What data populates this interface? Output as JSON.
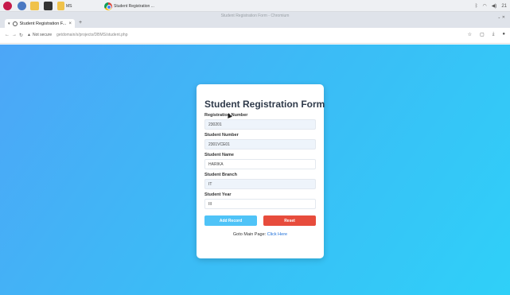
{
  "taskbar": {
    "item_label": "MS",
    "window_button": "Student Registration ...",
    "clock": "21"
  },
  "window": {
    "title": "Student Registration Form - Chromium"
  },
  "browser": {
    "tab_label": "Student Registration F...",
    "new_tab": "+",
    "security": "Not secure",
    "url": "getdomain/s/projects/DBMS/student.php"
  },
  "form": {
    "title": "Student Registration Form",
    "fields": [
      {
        "label": "Registration Number",
        "value": "230201"
      },
      {
        "label": "Student Number",
        "value": "2301VCE01"
      },
      {
        "label": "Student Name",
        "value": "HARIKA"
      },
      {
        "label": "Student Branch",
        "value": "IT"
      },
      {
        "label": "Student Year",
        "value": "III"
      }
    ],
    "submit_label": "Add Record",
    "reset_label": "Reset",
    "goto_text": "Goto Main Page:",
    "goto_link": "Click Here"
  },
  "colors": {
    "gradient_start": "#4da6f7",
    "gradient_end": "#2fd0f8",
    "submit": "#4fc3f7",
    "reset": "#e74c3c",
    "link": "#1e6fd9"
  }
}
